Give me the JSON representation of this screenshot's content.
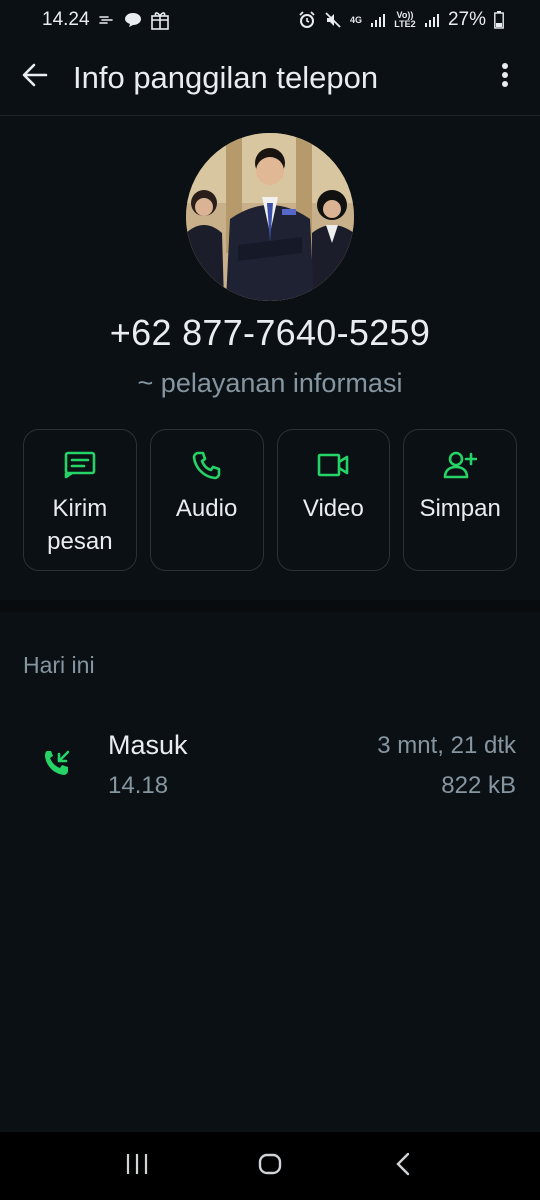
{
  "status_bar": {
    "time": "14.24",
    "network": "4G",
    "volte": "Vo)) LTE2",
    "battery": "27%",
    "icons": [
      "wind-icon",
      "chat-bubble-icon",
      "gift-icon",
      "alarm-icon",
      "mute-icon",
      "signal-icon",
      "battery-icon"
    ]
  },
  "app_bar": {
    "title": "Info panggilan telepon",
    "back_icon": "arrow-back-icon",
    "menu_icon": "more-vert-icon"
  },
  "profile": {
    "phone": "+62 877-7640-5259",
    "subtitle": "~ pelayanan informasi"
  },
  "actions": [
    {
      "label": "Kirim pesan",
      "icon": "message-icon"
    },
    {
      "label": "Audio",
      "icon": "phone-icon"
    },
    {
      "label": "Video",
      "icon": "video-icon"
    },
    {
      "label": "Simpan",
      "icon": "add-person-icon"
    }
  ],
  "history": {
    "section_title": "Hari ini",
    "calls": [
      {
        "type": "Masuk",
        "time": "14.18",
        "duration": "3 mnt, 21 dtk",
        "size": "822 kB",
        "icon": "incoming-call-icon"
      }
    ]
  },
  "colors": {
    "background": "#0b1014",
    "accent": "#25d366",
    "text_primary": "#e9edef",
    "text_secondary": "#8696a0",
    "border": "#2a3238"
  }
}
